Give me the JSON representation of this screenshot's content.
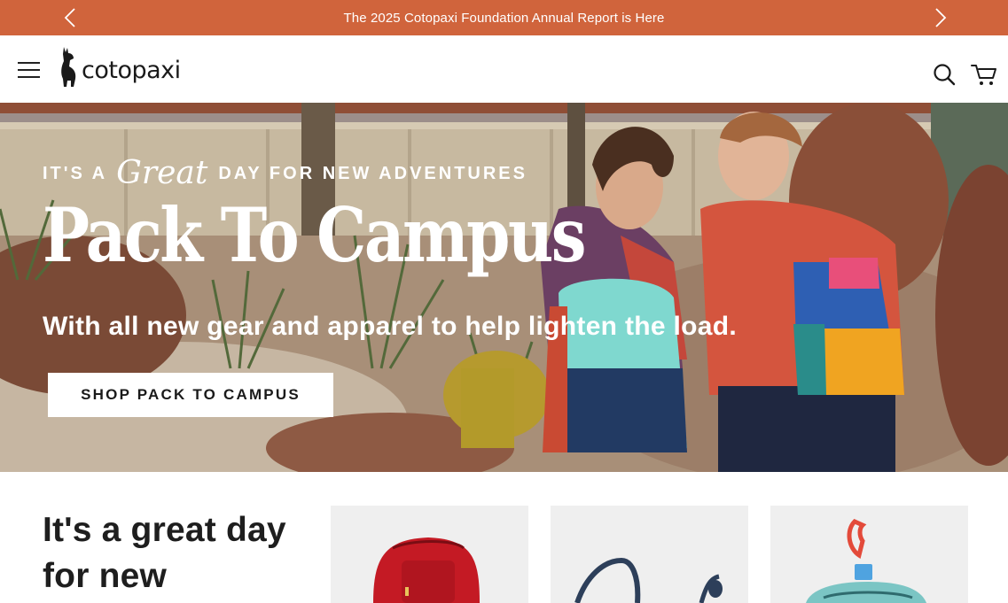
{
  "announcement": {
    "message": "The 2025 Cotopaxi Foundation Annual Report is Here",
    "prev_icon": "chevron-left-icon",
    "next_icon": "chevron-right-icon",
    "background_color": "#d0643c"
  },
  "header": {
    "menu_icon": "hamburger-menu-icon",
    "logo_text": "cotopaxi",
    "logo_icon": "llama-icon",
    "search_icon": "search-icon",
    "cart_icon": "cart-icon"
  },
  "hero": {
    "eyebrow_before": "IT'S A",
    "eyebrow_script": "Great",
    "eyebrow_after": "DAY FOR NEW ADVENTURES",
    "title": "Pack To Campus",
    "subtitle": "With all new gear and apparel to help lighten the load.",
    "cta_label": "SHOP PACK TO CAMPUS"
  },
  "section": {
    "heading": "It's a great day for new",
    "cards": [
      {
        "image": "red-backpack-image"
      },
      {
        "image": "navy-tote-bag-image"
      },
      {
        "image": "teal-clip-pouch-image"
      }
    ]
  }
}
